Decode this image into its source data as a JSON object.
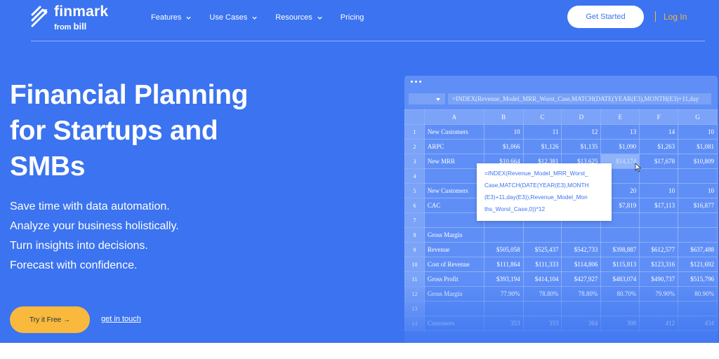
{
  "brand": {
    "name": "finmark",
    "from_prefix": "from",
    "from_brand": "bill"
  },
  "nav": {
    "items": [
      {
        "label": "Features",
        "has_dropdown": true
      },
      {
        "label": "Use Cases",
        "has_dropdown": true
      },
      {
        "label": "Resources",
        "has_dropdown": true
      },
      {
        "label": "Pricing",
        "has_dropdown": false
      }
    ],
    "cta_label": "Get Started",
    "login_label": "Log In"
  },
  "hero": {
    "headline": [
      "Financial Planning",
      "for Startups and",
      "SMBs"
    ],
    "features": [
      "Save time with data automation.",
      "Analyze your business holistically.",
      "Turn insights into decisions.",
      "Forecast with confidence."
    ],
    "primary_button": "Try it Free →",
    "secondary_link": "get in touch"
  },
  "spreadsheet": {
    "formula_bar": "=INDEX(Revenue_Model_MRR_Worst_Case,MATCH(DATE(YEAR(E3),MONTH(E3)+11,day",
    "columns": [
      "A",
      "B",
      "C",
      "D",
      "E",
      "F",
      "G"
    ],
    "rows": [
      {
        "num": "1",
        "label": "New Customers",
        "cells": [
          "10",
          "11",
          "12",
          "13",
          "14",
          "10"
        ]
      },
      {
        "num": "2",
        "label": "ARPC",
        "cells": [
          "$1,066",
          "$1,126",
          "$1,135",
          "$1,090",
          "$1,263",
          "$1,081"
        ]
      },
      {
        "num": "3",
        "label": "New MRR",
        "cells": [
          "$10,664",
          "$12,381",
          "$13,625",
          "$14,174",
          "$17,678",
          "$10,809"
        ]
      },
      {
        "num": "4",
        "label": "",
        "cells": [
          "",
          "",
          "",
          "",
          "",
          ""
        ]
      },
      {
        "num": "5",
        "label": "New Customers",
        "cells": [
          "",
          "",
          "",
          "20",
          "10",
          "10"
        ]
      },
      {
        "num": "6",
        "label": "CAC",
        "cells": [
          "",
          "",
          "",
          "$7,819",
          "$17,113",
          "$16,877"
        ]
      },
      {
        "num": "7",
        "label": "",
        "cells": [
          "",
          "",
          "",
          "",
          "",
          ""
        ]
      },
      {
        "num": "8",
        "label": "Gross Margin",
        "cells": [
          "",
          "",
          "",
          "",
          "",
          ""
        ]
      },
      {
        "num": "9",
        "label": "Revenue",
        "cells": [
          "$505,058",
          "$525,437",
          "$542,733",
          "$398,887",
          "$612,577",
          "$637,488"
        ]
      },
      {
        "num": "10",
        "label": "Cost of Revenue",
        "cells": [
          "$111,864",
          "$111,333",
          "$114,806",
          "$115,813",
          "$123,316",
          "$121,692"
        ]
      },
      {
        "num": "11",
        "label": "Gross Profit",
        "cells": [
          "$393,194",
          "$414,104",
          "$427,927",
          "$483,074",
          "$490,737",
          "$515,796"
        ]
      },
      {
        "num": "12",
        "label": "Gross Margin",
        "cells": [
          "77.90%",
          "78.80%",
          "78.80%",
          "80.70%",
          "79.90%",
          "80.90%"
        ]
      },
      {
        "num": "13",
        "label": "",
        "cells": [
          "",
          "",
          "",
          "",
          "",
          ""
        ]
      },
      {
        "num": "14",
        "label": "Customers",
        "cells": [
          "353",
          "353",
          "364",
          "398",
          "412",
          "434"
        ]
      }
    ],
    "selected_cell": "E3",
    "tooltip_formula": "=INDEX(Revenue_Model_MRR_Worst_\nCase,MATCH(DATE(YEAR(E3),MONTH\n(E3)+11,day(E3)),Revenue_Model_Mon\nths_Worst_Case,0))*12"
  },
  "colors": {
    "hero_bg": "#3b73f0",
    "accent_yellow": "#f8b93c",
    "login_orange": "#f7b832",
    "sheet_bg": "#5f8ff6",
    "header_cells": "#7ba3f8"
  },
  "icons": [
    "finmark-logo-icon",
    "chevron-down-icon",
    "caret-down-icon",
    "mouse-cursor-icon"
  ]
}
